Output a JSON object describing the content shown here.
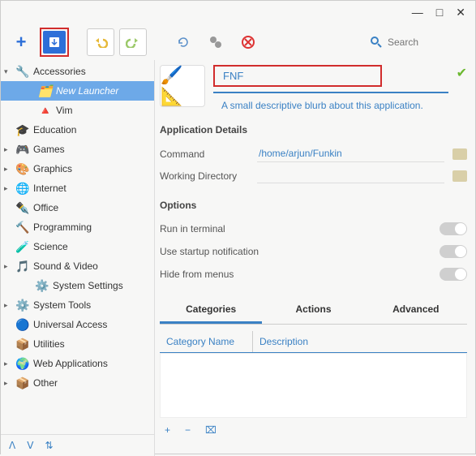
{
  "window": {
    "min": "—",
    "max": "□",
    "close": "✕"
  },
  "toolbar": {
    "search_placeholder": "Search"
  },
  "sidebar": {
    "items": [
      {
        "label": "Accessories",
        "icon": "🔧",
        "state": "expanded"
      },
      {
        "label": "New Launcher",
        "icon": "🗂️",
        "state": "child",
        "selected": true
      },
      {
        "label": "Vim",
        "icon": "🔺",
        "state": "child"
      },
      {
        "label": "Education",
        "icon": "🎓",
        "state": "leaf"
      },
      {
        "label": "Games",
        "icon": "🎮",
        "state": "collapsed"
      },
      {
        "label": "Graphics",
        "icon": "🎨",
        "state": "collapsed"
      },
      {
        "label": "Internet",
        "icon": "🌐",
        "state": "collapsed"
      },
      {
        "label": "Office",
        "icon": "✒️",
        "state": "leaf"
      },
      {
        "label": "Programming",
        "icon": "🔨",
        "state": "leaf"
      },
      {
        "label": "Science",
        "icon": "🧪",
        "state": "leaf"
      },
      {
        "label": "Sound & Video",
        "icon": "🎵",
        "state": "collapsed"
      },
      {
        "label": "System Settings",
        "icon": "⚙️",
        "state": "leaf-indent"
      },
      {
        "label": "System Tools",
        "icon": "⚙️",
        "state": "collapsed"
      },
      {
        "label": "Universal Access",
        "icon": "🔵",
        "state": "leaf"
      },
      {
        "label": "Utilities",
        "icon": "📦",
        "state": "leaf"
      },
      {
        "label": "Web Applications",
        "icon": "🌍",
        "state": "collapsed"
      },
      {
        "label": "Other",
        "icon": "📦",
        "state": "collapsed"
      }
    ]
  },
  "app": {
    "name": "FNF",
    "blurb": "A small descriptive blurb about this application."
  },
  "details": {
    "heading": "Application Details",
    "rows": [
      {
        "label": "Command",
        "value": "/home/arjun/Funkin"
      },
      {
        "label": "Working Directory",
        "value": ""
      }
    ]
  },
  "options": {
    "heading": "Options",
    "items": [
      {
        "label": "Run in terminal"
      },
      {
        "label": "Use startup notification"
      },
      {
        "label": "Hide from menus"
      }
    ]
  },
  "tabs": {
    "items": [
      {
        "label": "Categories",
        "active": true
      },
      {
        "label": "Actions"
      },
      {
        "label": "Advanced"
      }
    ]
  },
  "table": {
    "cols": [
      "Category Name",
      "Description"
    ]
  }
}
